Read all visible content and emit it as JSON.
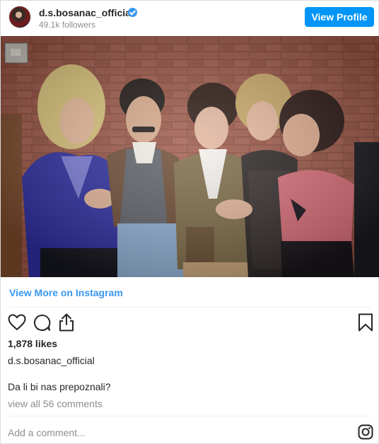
{
  "header": {
    "username": "d.s.bosanac_official",
    "followers": "49.1k followers",
    "view_profile_label": "View Profile"
  },
  "post": {
    "view_more_label": "View More on Instagram",
    "likes": "1,878 likes",
    "caption_username": "d.s.bosanac_official",
    "caption_text": "Da li bi nas prepoznali?",
    "view_comments": "view all 56 comments"
  },
  "footer": {
    "add_comment_placeholder": "Add a comment..."
  },
  "icons": {
    "verified": "verified-badge-icon",
    "like": "heart-icon",
    "comment": "comment-icon",
    "share": "share-icon",
    "save": "bookmark-icon",
    "instagram": "instagram-logo-icon"
  },
  "colors": {
    "accent": "#0095f6",
    "link": "#3897f0",
    "secondary_text": "#8e8e8e"
  }
}
